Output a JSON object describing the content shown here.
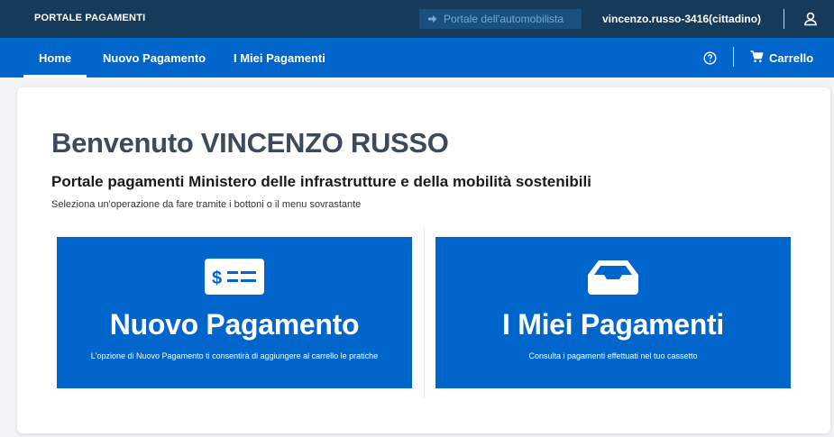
{
  "topbar": {
    "brand": "PORTALE PAGAMENTI",
    "auto_link": "Portale dell'automobilista",
    "user": "vincenzo.russo-3416(cittadino)",
    "icons": {
      "auto_link": "sign-in-icon",
      "user": "user-icon"
    }
  },
  "nav": {
    "items": [
      {
        "label": "Home",
        "active": true
      },
      {
        "label": "Nuovo Pagamento",
        "active": false
      },
      {
        "label": "I Miei Pagamenti",
        "active": false
      }
    ],
    "cart": "Carrello",
    "icons": {
      "help": "help-circle-icon",
      "cart": "cart-icon"
    }
  },
  "main": {
    "welcome": "Benvenuto VINCENZO RUSSO",
    "subtitle": "Portale pagamenti Ministero delle infrastrutture e della mobilità sostenibili",
    "instructions": "Seleziona un'operazione da fare tramite i bottoni o il menu sovrastante",
    "cards": [
      {
        "title": "Nuovo Pagamento",
        "description": "L'opzione di Nuovo Pagamento ti consentirà di aggiungere al carrello le pratiche",
        "icon": "money-bill-icon"
      },
      {
        "title": "I Miei Pagamenti",
        "description": "Consulta i pagamenti effettuati nel tuo cassetto",
        "icon": "inbox-tray-icon"
      }
    ]
  },
  "colors": {
    "topbar": "#163a5a",
    "navbar": "#0066cc",
    "card": "#0066cc",
    "background": "#f3f3f5",
    "heading": "#3c4a5c"
  }
}
